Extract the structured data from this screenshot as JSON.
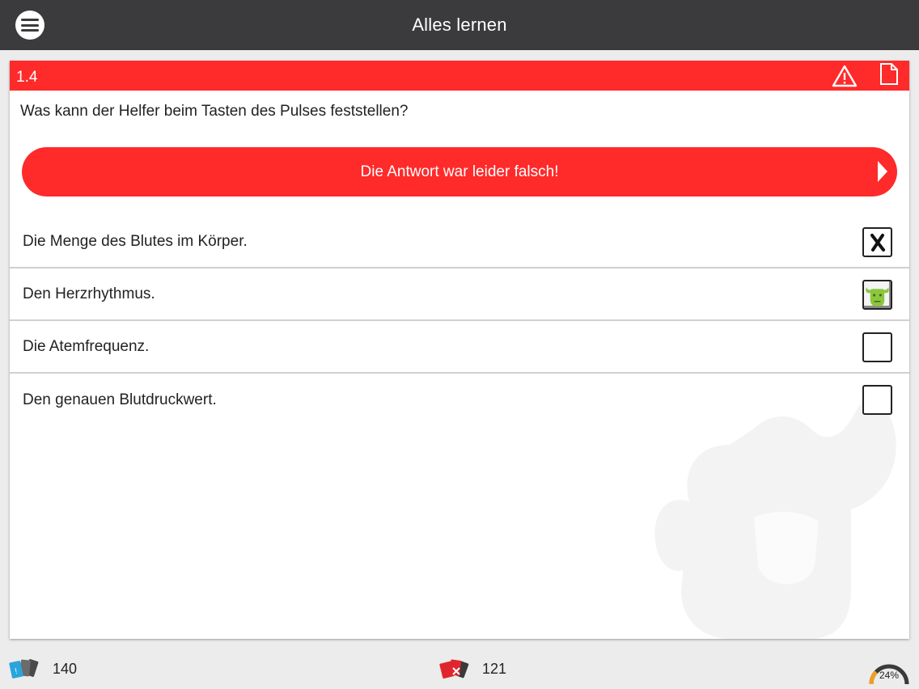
{
  "appbar": {
    "title": "Alles lernen",
    "menu_icon": "menu-icon"
  },
  "question_card": {
    "number": "1.4",
    "header_color": "#ff2a2a",
    "icons": [
      "warning-icon",
      "document-icon"
    ],
    "question": "Was kann der Helfer beim Tasten des Pulses feststellen?",
    "result_message": "Die Antwort war leider falsch!",
    "answers": [
      {
        "text": "Die Menge des Blutes im Körper.",
        "state": "marked-wrong"
      },
      {
        "text": "Den Herzrhythmus.",
        "state": "correct"
      },
      {
        "text": "Die Atemfrequenz.",
        "state": "unchecked"
      },
      {
        "text": "Den genauen Blutdruckwert.",
        "state": "unchecked"
      }
    ]
  },
  "bottombar": {
    "left_count": "140",
    "left_icon": "blue-cards-icon",
    "mid_count": "121",
    "mid_icon": "red-cards-icon",
    "progress_label": "24%",
    "progress_value": 0.24
  }
}
